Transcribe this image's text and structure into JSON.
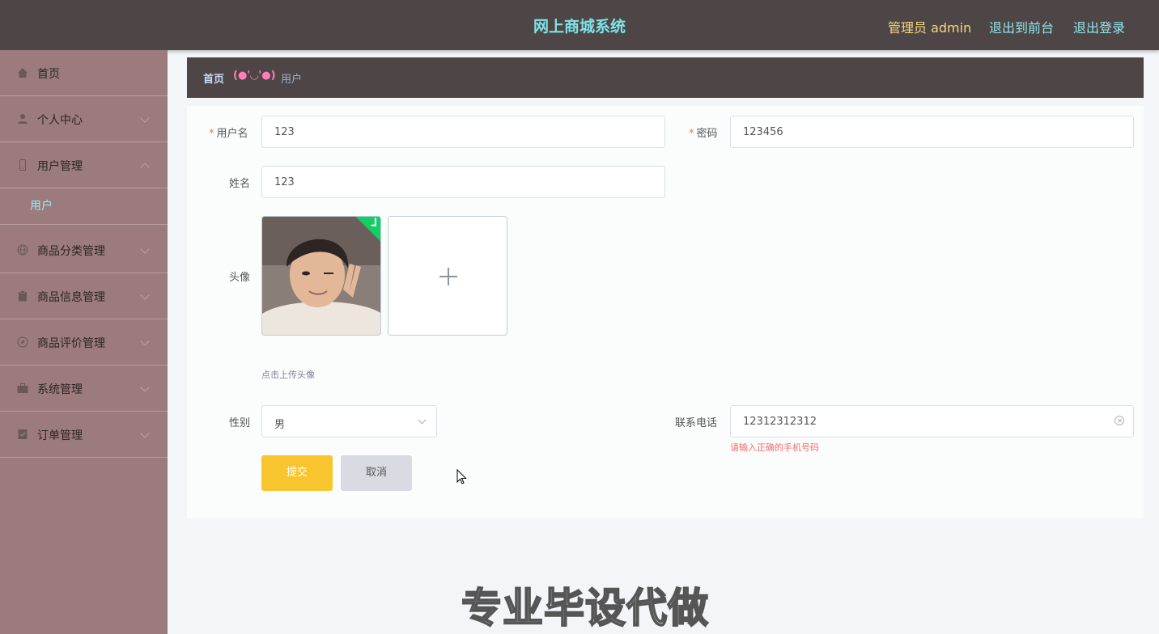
{
  "header": {
    "title": "网上商城系统",
    "admin_label": "管理员 admin",
    "to_frontend": "退出到前台",
    "logout": "退出登录"
  },
  "sidebar": {
    "items": [
      {
        "label": "首页",
        "icon": "home-icon"
      },
      {
        "label": "个人中心",
        "icon": "user-icon"
      },
      {
        "label": "用户管理",
        "icon": "phone-icon"
      },
      {
        "label": "商品分类管理",
        "icon": "globe-icon"
      },
      {
        "label": "商品信息管理",
        "icon": "clipboard-icon"
      },
      {
        "label": "商品评价管理",
        "icon": "compass-icon"
      },
      {
        "label": "系统管理",
        "icon": "briefcase-icon"
      },
      {
        "label": "订单管理",
        "icon": "document-icon"
      }
    ],
    "submenu": {
      "label": "用户"
    }
  },
  "breadcrumb": {
    "home": "首页",
    "separator": "(●'◡'●)",
    "current": "用户"
  },
  "form": {
    "username": {
      "label": "用户名",
      "required": "*",
      "value": "123"
    },
    "password": {
      "label": "密码",
      "required": "*",
      "value": "123456"
    },
    "name": {
      "label": "姓名",
      "value": "123"
    },
    "avatar": {
      "label": "头像",
      "tip": "点击上传头像"
    },
    "gender": {
      "label": "性别",
      "value": "男"
    },
    "phone": {
      "label": "联系电话",
      "value": "12312312312",
      "error": "请输入正确的手机号码"
    },
    "submit_label": "提交",
    "cancel_label": "取消"
  },
  "colors": {
    "header_bg": "#4e4646",
    "sidebar_bg": "#9b7b7d",
    "title": "#7fe3e8",
    "submit": "#f8c52f",
    "error": "#f56c6c"
  },
  "watermark": "专业毕设代做"
}
